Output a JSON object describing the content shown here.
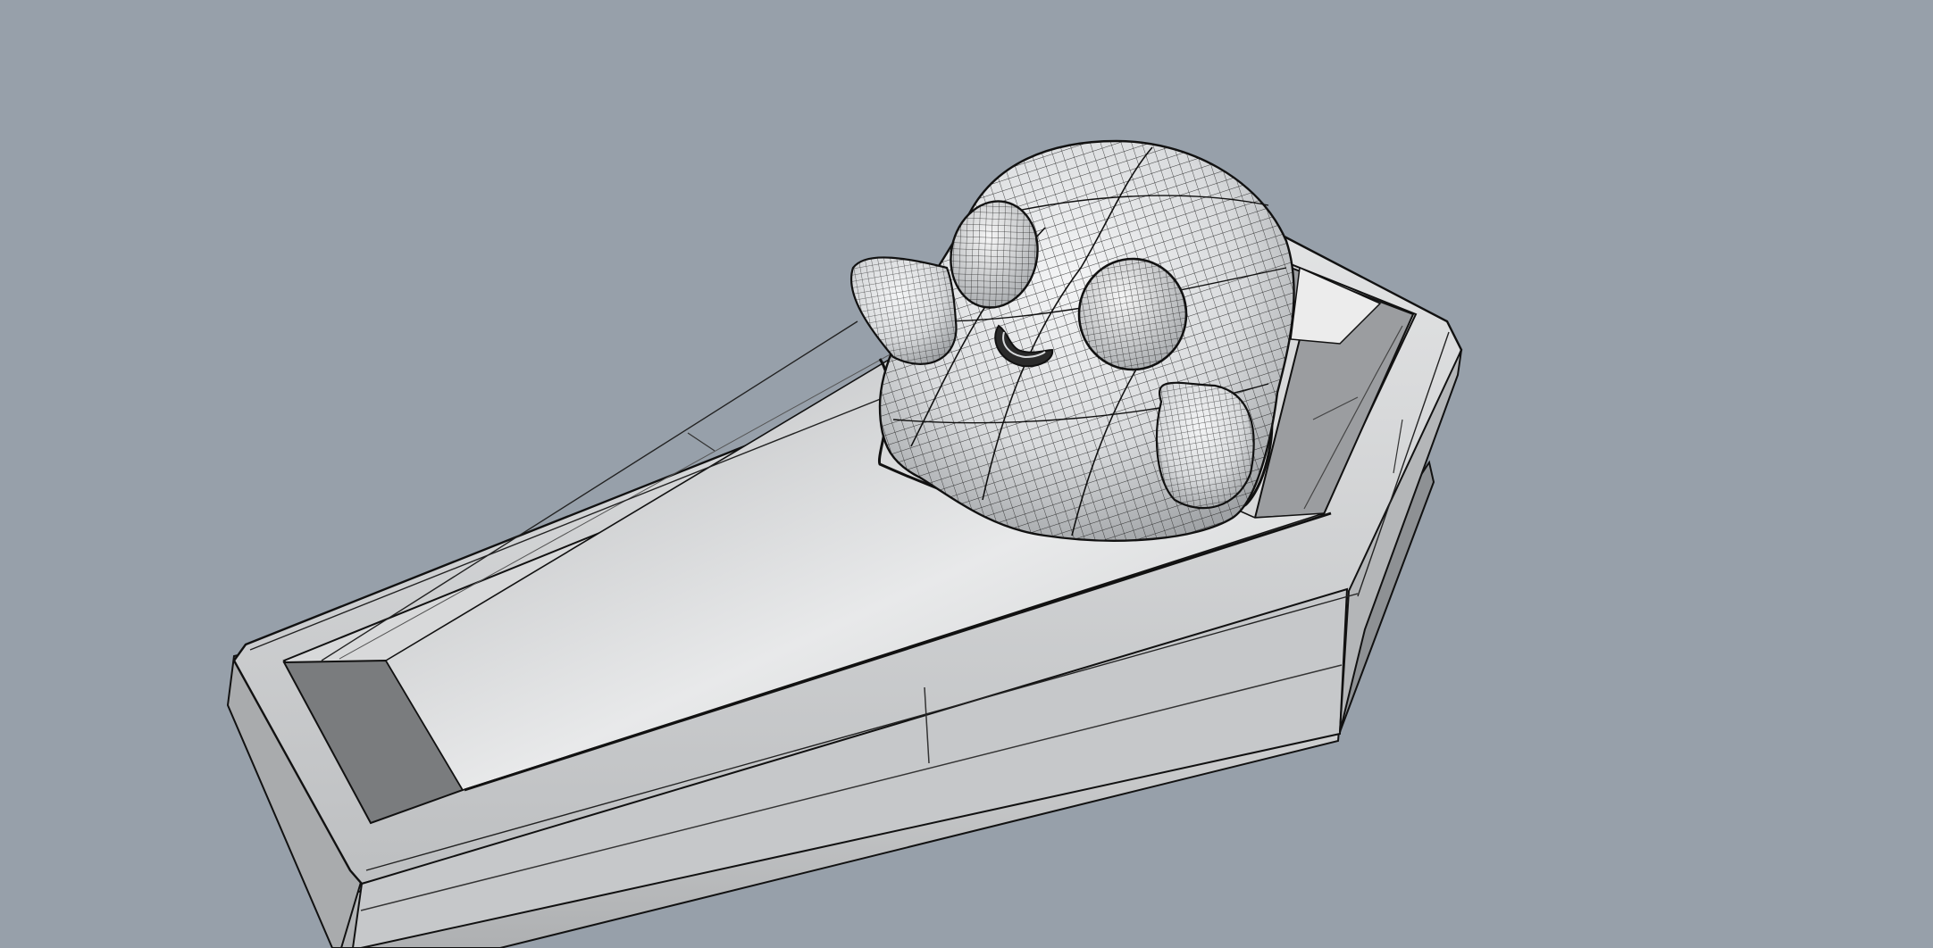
{
  "viewport": {
    "background": "#97a0aa",
    "display_mode": "shaded-with-wireframe",
    "objects": [
      {
        "name": "coffin",
        "icon": "coffin-model-icon",
        "base_color": "#c9cbcd",
        "edge_color": "#1a1a1a"
      },
      {
        "name": "ghost",
        "icon": "ghost-model-icon",
        "base_color": "#e4e6e8",
        "edge_color": "#111111"
      }
    ]
  }
}
